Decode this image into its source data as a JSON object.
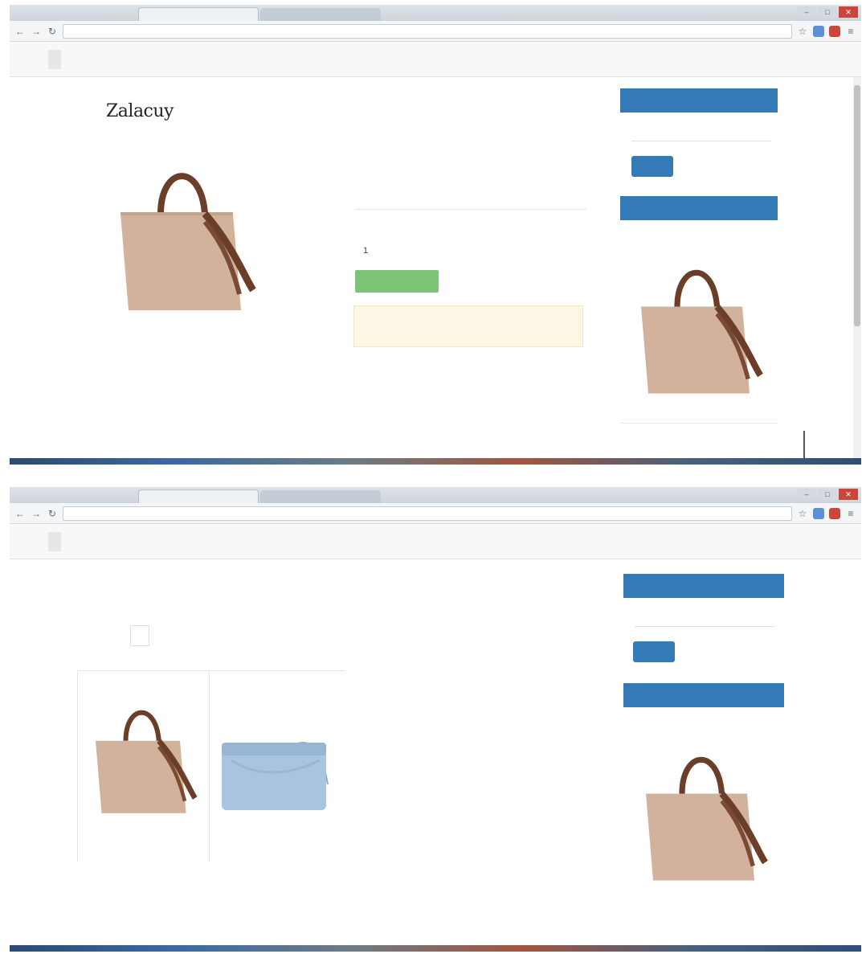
{
  "shot1": {
    "tabs": [
      "",
      ""
    ],
    "url": "",
    "nav": {
      "brand": "",
      "items": [
        "",
        "",
        "",
        "",
        ""
      ],
      "right": ""
    },
    "product": {
      "brand_logo": "Zalacuy",
      "caption": "",
      "title": "",
      "field1_label": "",
      "field1_value": "",
      "field2_label": "",
      "field2_value": "",
      "field3_label": "",
      "field3_value": "",
      "quantity_label": "",
      "quantity_value": "1",
      "add_button": "",
      "alert_text": ""
    },
    "sidebar": {
      "search_title": "",
      "search_placeholder": "",
      "go_label": "",
      "promo_title": "",
      "promo_name": "",
      "promo_price": ""
    }
  },
  "shot2": {
    "tabs": [
      "",
      ""
    ],
    "url": "",
    "nav": {
      "brand": "",
      "items": [
        "",
        "",
        "",
        "",
        ""
      ],
      "right1": "",
      "right2": ""
    },
    "listing": {
      "breadcrumb": "",
      "heading": "",
      "filter_label": "",
      "products": [
        {
          "name": "",
          "price": ""
        },
        {
          "name": "",
          "price": ""
        }
      ]
    },
    "sidebar": {
      "search_title": "",
      "search_placeholder": "",
      "go_label": "",
      "promo_title": "",
      "promo_name": "",
      "promo_price": ""
    }
  },
  "colors": {
    "primary_blue": "#337ab7",
    "success_green": "#7cc576",
    "alert_bg": "#fcf6e4",
    "bag_tan": "#d2b29c",
    "strap_brown": "#6b3e2a",
    "bag_blue": "#a9c4df"
  },
  "icons": [
    "back-arrow-icon",
    "forward-arrow-icon",
    "reload-icon",
    "star-icon",
    "extension-icon",
    "menu-icon",
    "close-icon",
    "handbag-image"
  ]
}
